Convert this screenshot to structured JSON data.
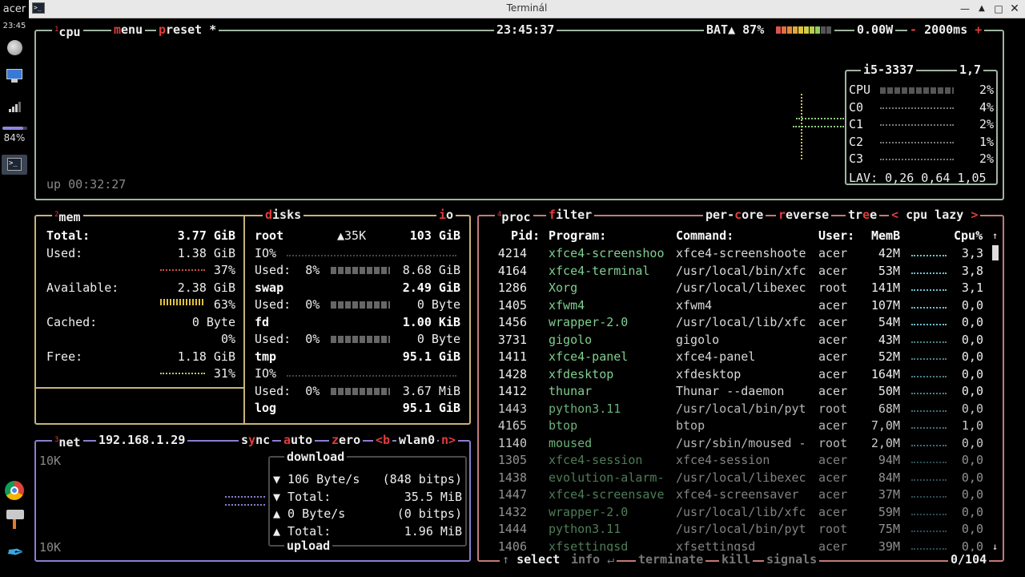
{
  "panel": {
    "user": "acer",
    "clock": "23:45",
    "volume_pct": 0.84,
    "volume_label": "84%"
  },
  "window": {
    "title": "Terminál"
  },
  "cpu_box": {
    "num": "1",
    "name": "cpu",
    "menu": "menu",
    "preset": "preset *",
    "time": "23:45:37",
    "battery_label": "BAT▲ 87%",
    "battery_pct": 0.87,
    "power": "0.00W",
    "interval": "2000ms",
    "minus": "-",
    "plus": "+",
    "uptime": "up 00:32:27",
    "cpu_model": "i5-3337",
    "freq": "1,7",
    "cores": [
      {
        "name": "CPU",
        "pct": "2%"
      },
      {
        "name": "C0",
        "pct": "4%"
      },
      {
        "name": "C1",
        "pct": "2%"
      },
      {
        "name": "C2",
        "pct": "1%"
      },
      {
        "name": "C3",
        "pct": "2%"
      }
    ],
    "lav": "LAV: 0,26 0,64 1,05"
  },
  "mem_box": {
    "num": "2",
    "name": "mem",
    "total_label": "Total:",
    "total": "3.77 GiB",
    "used_label": "Used:",
    "used": "1.38 GiB",
    "used_pct": "37%",
    "avail_label": "Available:",
    "avail": "2.38 GiB",
    "avail_pct": "63%",
    "cached_label": "Cached:",
    "cached": "0 Byte",
    "cached_pct": "0%",
    "free_label": "Free:",
    "free": "1.18 GiB",
    "free_pct": "31%"
  },
  "disks_box": {
    "name": "disks",
    "io": "io",
    "rows": [
      {
        "a": "root",
        "b": "▲35K",
        "c": "103 GiB"
      },
      {
        "a": "IO%",
        "b": "",
        "c": ""
      },
      {
        "a": "Used:  8%",
        "b": "",
        "c": "8.68 GiB"
      },
      {
        "a": "swap",
        "b": "",
        "c": "2.49 GiB"
      },
      {
        "a": "Used:  0%",
        "b": "",
        "c": "0 Byte"
      },
      {
        "a": "fd",
        "b": "",
        "c": "1.00 KiB"
      },
      {
        "a": "Used:  0%",
        "b": "",
        "c": "0 Byte"
      },
      {
        "a": "tmp",
        "b": "",
        "c": "95.1 GiB"
      },
      {
        "a": "IO%",
        "b": "",
        "c": ""
      },
      {
        "a": "Used:  0%",
        "b": "",
        "c": "3.67 MiB"
      },
      {
        "a": "log",
        "b": "",
        "c": "95.1 GiB"
      }
    ]
  },
  "net_box": {
    "num": "3",
    "name": "net",
    "ip": "192.168.1.29",
    "sync": "sync",
    "auto": "auto",
    "zero": "zero",
    "prev": "<b",
    "iface": "wlan0",
    "next": "n>",
    "scale_top": "10K",
    "scale_bottom": "10K",
    "download": "download",
    "upload": "upload",
    "dl_rate": "▼ 106 Byte/s",
    "dl_bits": "(848 bitps)",
    "dl_total_label": "▼ Total:",
    "dl_total": "35.5 MiB",
    "ul_rate": "▲ 0 Byte/s",
    "ul_bits": "(0 bitps)",
    "ul_total_label": "▲ Total:",
    "ul_total": "1.96 MiB"
  },
  "proc_box": {
    "num": "4",
    "name": "proc",
    "filter": "filter",
    "percore": "per-core",
    "reverse": "reverse",
    "tree": "tree",
    "sort": "cpu lazy",
    "sort_prev": "<",
    "sort_next": ">",
    "headers": {
      "pid": "Pid:",
      "program": "Program:",
      "command": "Command:",
      "user": "User:",
      "mem": "MemB",
      "cpu": "Cpu%"
    },
    "rows": [
      {
        "pid": "4214",
        "program": "xfce4-screenshoo",
        "command": "xfce4-screenshoote",
        "user": "acer",
        "mem": "42M",
        "cpu": "3,3"
      },
      {
        "pid": "4164",
        "program": "xfce4-terminal",
        "command": "/usr/local/bin/xfc",
        "user": "acer",
        "mem": "53M",
        "cpu": "3,8"
      },
      {
        "pid": "1286",
        "program": "Xorg",
        "command": "/usr/local/libexec",
        "user": "root",
        "mem": "141M",
        "cpu": "3,1"
      },
      {
        "pid": "1405",
        "program": "xfwm4",
        "command": "xfwm4",
        "user": "acer",
        "mem": "107M",
        "cpu": "0,0"
      },
      {
        "pid": "1456",
        "program": "wrapper-2.0",
        "command": "/usr/local/lib/xfc",
        "user": "acer",
        "mem": "54M",
        "cpu": "0,0"
      },
      {
        "pid": "3731",
        "program": "gigolo",
        "command": "gigolo",
        "user": "acer",
        "mem": "43M",
        "cpu": "0,0"
      },
      {
        "pid": "1411",
        "program": "xfce4-panel",
        "command": "xfce4-panel",
        "user": "acer",
        "mem": "52M",
        "cpu": "0,0"
      },
      {
        "pid": "1428",
        "program": "xfdesktop",
        "command": "xfdesktop",
        "user": "acer",
        "mem": "164M",
        "cpu": "0,0"
      },
      {
        "pid": "1412",
        "program": "thunar",
        "command": "Thunar --daemon",
        "user": "acer",
        "mem": "50M",
        "cpu": "0,0"
      },
      {
        "pid": "1443",
        "program": "python3.11",
        "command": "/usr/local/bin/pyt",
        "user": "root",
        "mem": "68M",
        "cpu": "0,0"
      },
      {
        "pid": "4165",
        "program": "btop",
        "command": "btop",
        "user": "acer",
        "mem": "7,0M",
        "cpu": "1,0"
      },
      {
        "pid": "1140",
        "program": "moused",
        "command": "/usr/sbin/moused -",
        "user": "root",
        "mem": "2,0M",
        "cpu": "0,0"
      },
      {
        "pid": "1305",
        "program": "xfce4-session",
        "command": "xfce4-session",
        "user": "acer",
        "mem": "94M",
        "cpu": "0,0"
      },
      {
        "pid": "1438",
        "program": "evolution-alarm-",
        "command": "/usr/local/libexec",
        "user": "acer",
        "mem": "84M",
        "cpu": "0,0"
      },
      {
        "pid": "1447",
        "program": "xfce4-screensave",
        "command": "xfce4-screensaver",
        "user": "acer",
        "mem": "37M",
        "cpu": "0,0"
      },
      {
        "pid": "1432",
        "program": "wrapper-2.0",
        "command": "/usr/local/lib/xfc",
        "user": "acer",
        "mem": "59M",
        "cpu": "0,0"
      },
      {
        "pid": "1444",
        "program": "python3.11",
        "command": "/usr/local/bin/pyt",
        "user": "root",
        "mem": "75M",
        "cpu": "0,0"
      },
      {
        "pid": "1406",
        "program": "xfsettingsd",
        "command": "xfsettingsd",
        "user": "acer",
        "mem": "39M",
        "cpu": "0,0"
      }
    ],
    "footer": {
      "select": "select",
      "info": "info",
      "terminate": "terminate",
      "kill": "kill",
      "signals": "signals",
      "count": "0/104"
    }
  },
  "colors": {
    "cpu_border": "#9fb59f",
    "mem_border": "#c9b27a",
    "net_border": "#8a7fd0",
    "proc_border": "#c47a7a",
    "prog_green": "#7fcf8f",
    "key_red": "#e03c3c"
  }
}
